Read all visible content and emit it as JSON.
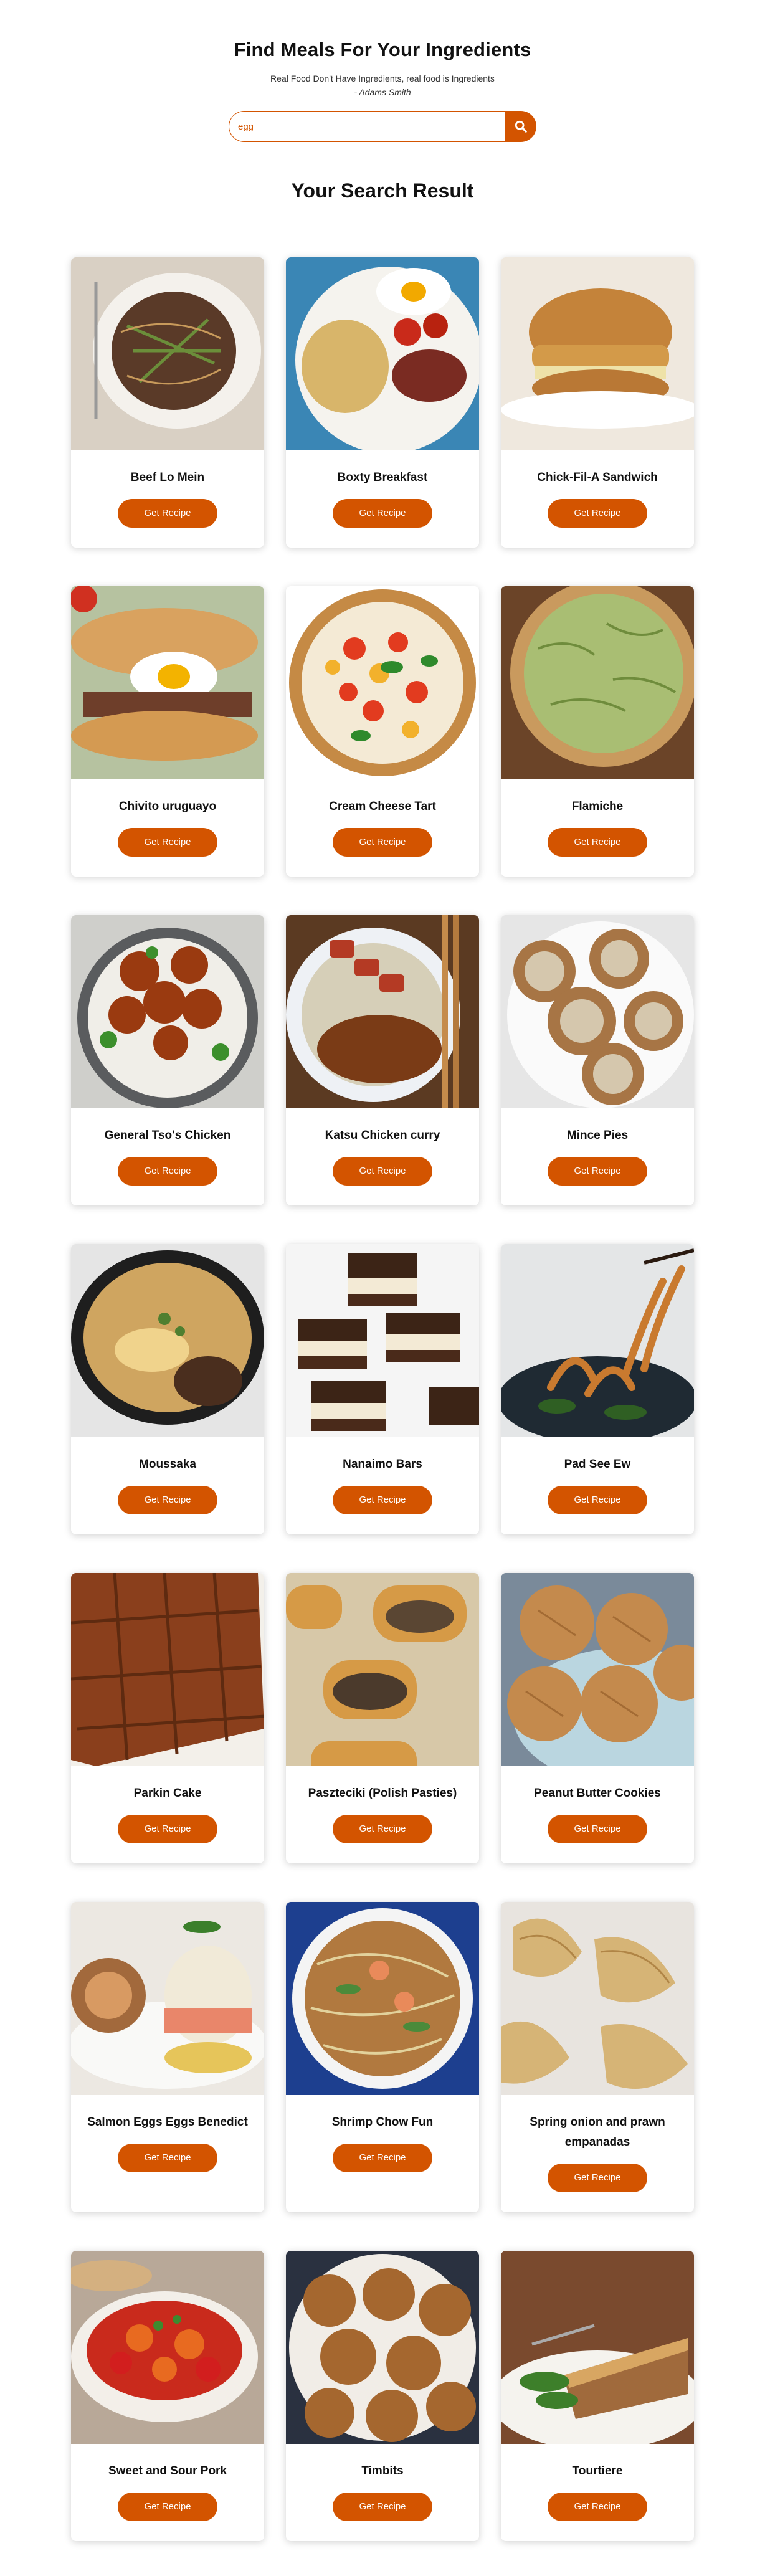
{
  "header": {
    "title": "Find Meals For Your Ingredients",
    "quote": "Real Food Don't Have Ingredients, real food is Ingredients",
    "author": "- Adams Smith"
  },
  "search": {
    "value": "egg",
    "icon": "search-icon"
  },
  "results": {
    "title": "Your Search Result",
    "button_label": "Get Recipe",
    "meals": [
      {
        "name": "Beef Lo Mein",
        "theme": "lomein"
      },
      {
        "name": "Boxty Breakfast",
        "theme": "boxty"
      },
      {
        "name": "Chick-Fil-A Sandwich",
        "theme": "sandwich"
      },
      {
        "name": "Chivito uruguayo",
        "theme": "chivito"
      },
      {
        "name": "Cream Cheese Tart",
        "theme": "tart"
      },
      {
        "name": "Flamiche",
        "theme": "flamiche"
      },
      {
        "name": "General Tso's Chicken",
        "theme": "tso"
      },
      {
        "name": "Katsu Chicken curry",
        "theme": "katsu"
      },
      {
        "name": "Mince Pies",
        "theme": "mince"
      },
      {
        "name": "Moussaka",
        "theme": "moussaka"
      },
      {
        "name": "Nanaimo Bars",
        "theme": "nanaimo"
      },
      {
        "name": "Pad See Ew",
        "theme": "padseeew"
      },
      {
        "name": "Parkin Cake",
        "theme": "parkin"
      },
      {
        "name": "Paszteciki (Polish Pasties)",
        "theme": "pasties"
      },
      {
        "name": "Peanut Butter Cookies",
        "theme": "cookies"
      },
      {
        "name": "Salmon Eggs Eggs Benedict",
        "theme": "benedict"
      },
      {
        "name": "Shrimp Chow Fun",
        "theme": "chowfun"
      },
      {
        "name": "Spring onion and prawn empanadas",
        "theme": "empanadas"
      },
      {
        "name": "Sweet and Sour Pork",
        "theme": "sweetsour"
      },
      {
        "name": "Timbits",
        "theme": "timbits"
      },
      {
        "name": "Tourtiere",
        "theme": "tourtiere"
      }
    ]
  },
  "colors": {
    "accent": "#d35400"
  }
}
